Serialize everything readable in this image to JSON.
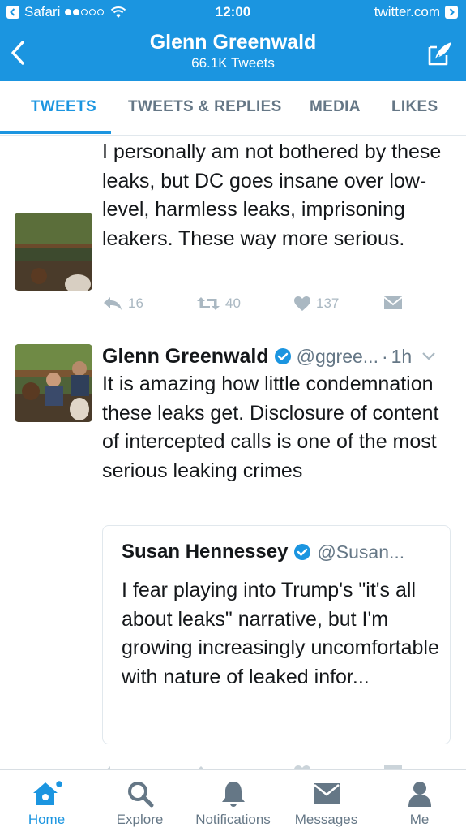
{
  "status_bar": {
    "back_app": "Safari",
    "time": "12:00",
    "url": "twitter.com"
  },
  "header": {
    "title": "Glenn Greenwald",
    "subtitle": "66.1K Tweets"
  },
  "tabs": [
    {
      "label": "TWEETS",
      "active": true
    },
    {
      "label": "TWEETS & REPLIES",
      "active": false
    },
    {
      "label": "MEDIA",
      "active": false
    },
    {
      "label": "LIKES",
      "active": false
    }
  ],
  "tweets": [
    {
      "text": "I personally am not bothered by these leaks, but DC goes insane over low-level, harmless leaks, imprisoning leakers. These way more serious.",
      "replies": "16",
      "retweets": "40",
      "likes": "137"
    },
    {
      "name": "Glenn Greenwald",
      "handle": "@ggree...",
      "time": "1h",
      "text": "It is amazing how little condemnation these leaks get. Disclosure of content of intercepted calls is one of the most serious leaking crimes",
      "quote": {
        "name": "Susan Hennessey",
        "handle": "@Susan...",
        "text": "I fear playing into Trump's \"it's all about leaks\" narrative, but I'm growing increasingly uncomfortable with nature of leaked infor..."
      }
    }
  ],
  "bottom_nav": [
    {
      "label": "Home",
      "icon": "home-icon",
      "active": true
    },
    {
      "label": "Explore",
      "icon": "search-icon",
      "active": false
    },
    {
      "label": "Notifications",
      "icon": "bell-icon",
      "active": false
    },
    {
      "label": "Messages",
      "icon": "envelope-icon",
      "active": false
    },
    {
      "label": "Me",
      "icon": "person-icon",
      "active": false
    }
  ],
  "colors": {
    "brand": "#1b95e0",
    "muted": "#657786",
    "action_gray": "#aab8c2"
  }
}
